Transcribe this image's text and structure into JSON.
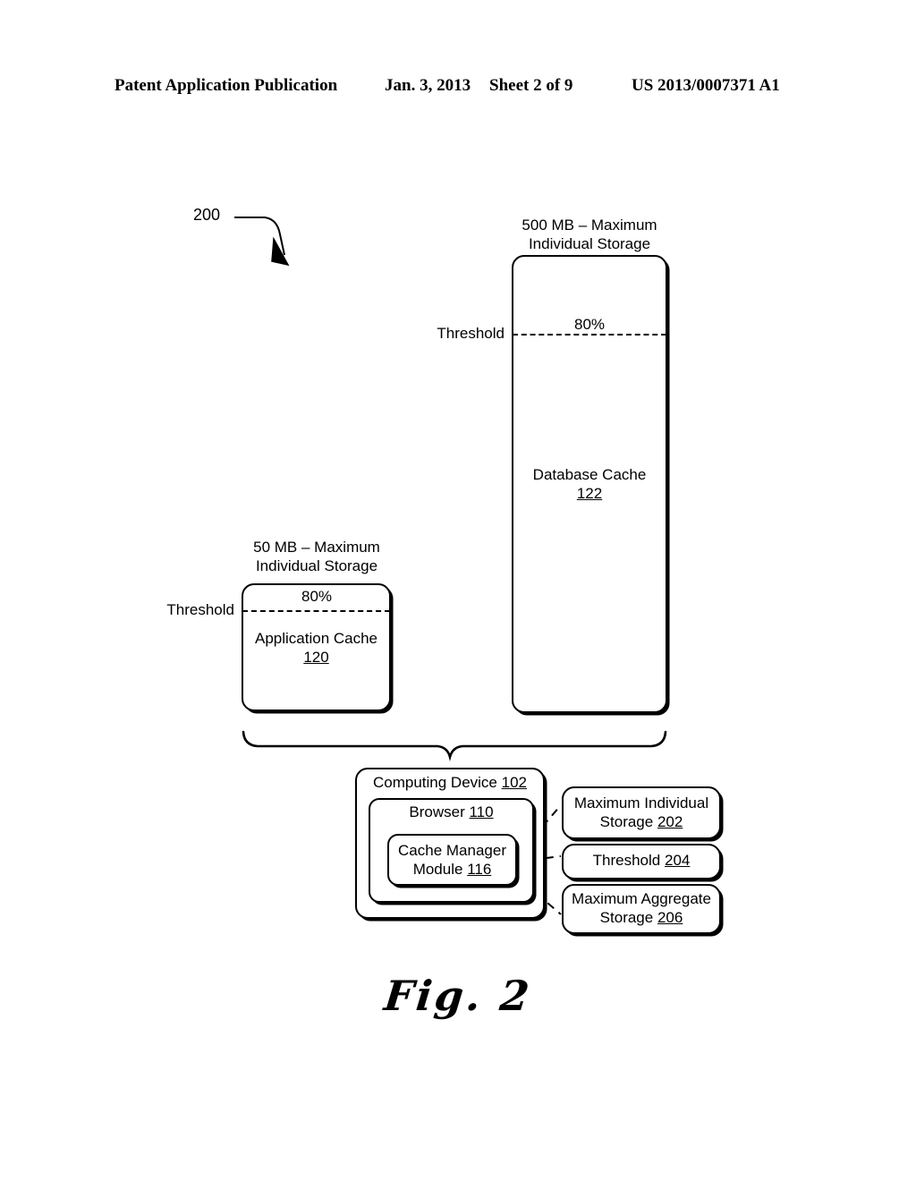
{
  "header": {
    "publication": "Patent Application Publication",
    "date": "Jan. 3, 2013",
    "sheet": "Sheet 2 of 9",
    "patent_number": "US 2013/0007371 A1"
  },
  "figure": {
    "reference_number": "200",
    "caption": "Fig. 2"
  },
  "database_cache": {
    "capacity_label": "500 MB – Maximum\nIndividual Storage",
    "threshold_label": "Threshold",
    "threshold_percent": "80%",
    "name": "Database Cache",
    "ref": "122"
  },
  "application_cache": {
    "capacity_label": "50 MB – Maximum\nIndividual Storage",
    "threshold_label": "Threshold",
    "threshold_percent": "80%",
    "name": "Application Cache",
    "ref": "120"
  },
  "computing_device": {
    "name": "Computing Device",
    "ref": "102",
    "browser": {
      "name": "Browser",
      "ref": "110",
      "cache_manager": {
        "name": "Cache Manager",
        "name_line2": "Module",
        "ref": "116"
      }
    }
  },
  "settings": [
    {
      "name": "Maximum Individual\nStorage",
      "ref": "202"
    },
    {
      "name": "Threshold",
      "ref": "204"
    },
    {
      "name": "Maximum Aggregate\nStorage",
      "ref": "206"
    }
  ]
}
